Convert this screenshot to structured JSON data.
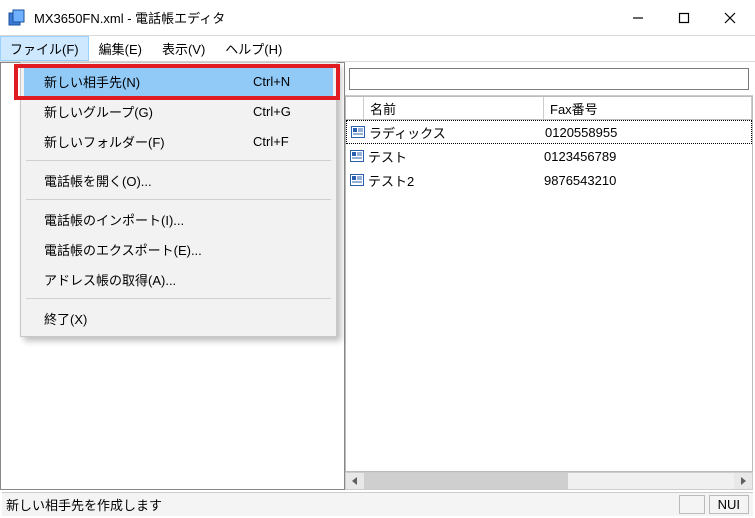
{
  "window": {
    "title": "MX3650FN.xml - 電話帳エディタ"
  },
  "menubar": {
    "file": "ファイル(F)",
    "edit": "編集(E)",
    "view": "表示(V)",
    "help": "ヘルプ(H)"
  },
  "file_menu": {
    "new_contact": {
      "label": "新しい相手先(N)",
      "shortcut": "Ctrl+N"
    },
    "new_group": {
      "label": "新しいグループ(G)",
      "shortcut": "Ctrl+G"
    },
    "new_folder": {
      "label": "新しいフォルダー(F)",
      "shortcut": "Ctrl+F"
    },
    "open_book": {
      "label": "電話帳を開く(O)..."
    },
    "import_book": {
      "label": "電話帳のインポート(I)..."
    },
    "export_book": {
      "label": "電話帳のエクスポート(E)..."
    },
    "get_address": {
      "label": "アドレス帳の取得(A)..."
    },
    "exit": {
      "label": "終了(X)"
    }
  },
  "filter": {
    "value": ""
  },
  "list": {
    "header": {
      "name": "名前",
      "fax": "Fax番号"
    },
    "rows": [
      {
        "name": "ラディックス",
        "fax": "0120558955"
      },
      {
        "name": "テスト",
        "fax": "0123456789"
      },
      {
        "name": "テスト2",
        "fax": "9876543210"
      }
    ]
  },
  "status": {
    "message": "新しい相手先を作成します",
    "cap": "NUI"
  }
}
